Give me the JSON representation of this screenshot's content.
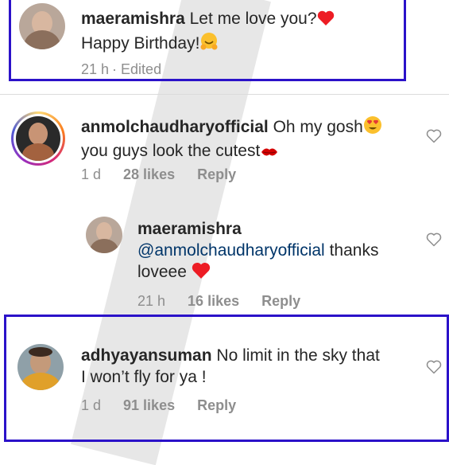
{
  "comments": [
    {
      "username": "maeramishra",
      "text_line1": "Let me love you?",
      "text_line2": "Happy Birthday!",
      "time": "21 h",
      "edited": "· Edited"
    },
    {
      "username": "anmolchaudharyofficial",
      "text_line1": "Oh my gosh",
      "text_line2": "you guys look the cutest",
      "time": "1 d",
      "likes": "28 likes",
      "reply": "Reply"
    },
    {
      "username": "maeramishra",
      "mention": "@anmolchaudharyofficial",
      "text_line1": "thanks",
      "text_line2": "loveee",
      "time": "21 h",
      "likes": "16 likes",
      "reply": "Reply"
    },
    {
      "username": "adhyayansuman",
      "text_line1": "No limit in the sky that",
      "text_line2": "I won’t fly for ya !",
      "time": "1 d",
      "likes": "91 likes",
      "reply": "Reply"
    }
  ],
  "colors": {
    "highlight_box": "#2b12c9",
    "mention": "#003569",
    "meta": "#8e8e8e",
    "heart_red": "#ed1c24"
  },
  "icons": [
    "heart-outline-icon",
    "red-heart-emoji",
    "hugging-face-emoji",
    "heart-eyes-emoji",
    "kiss-lips-emoji"
  ]
}
